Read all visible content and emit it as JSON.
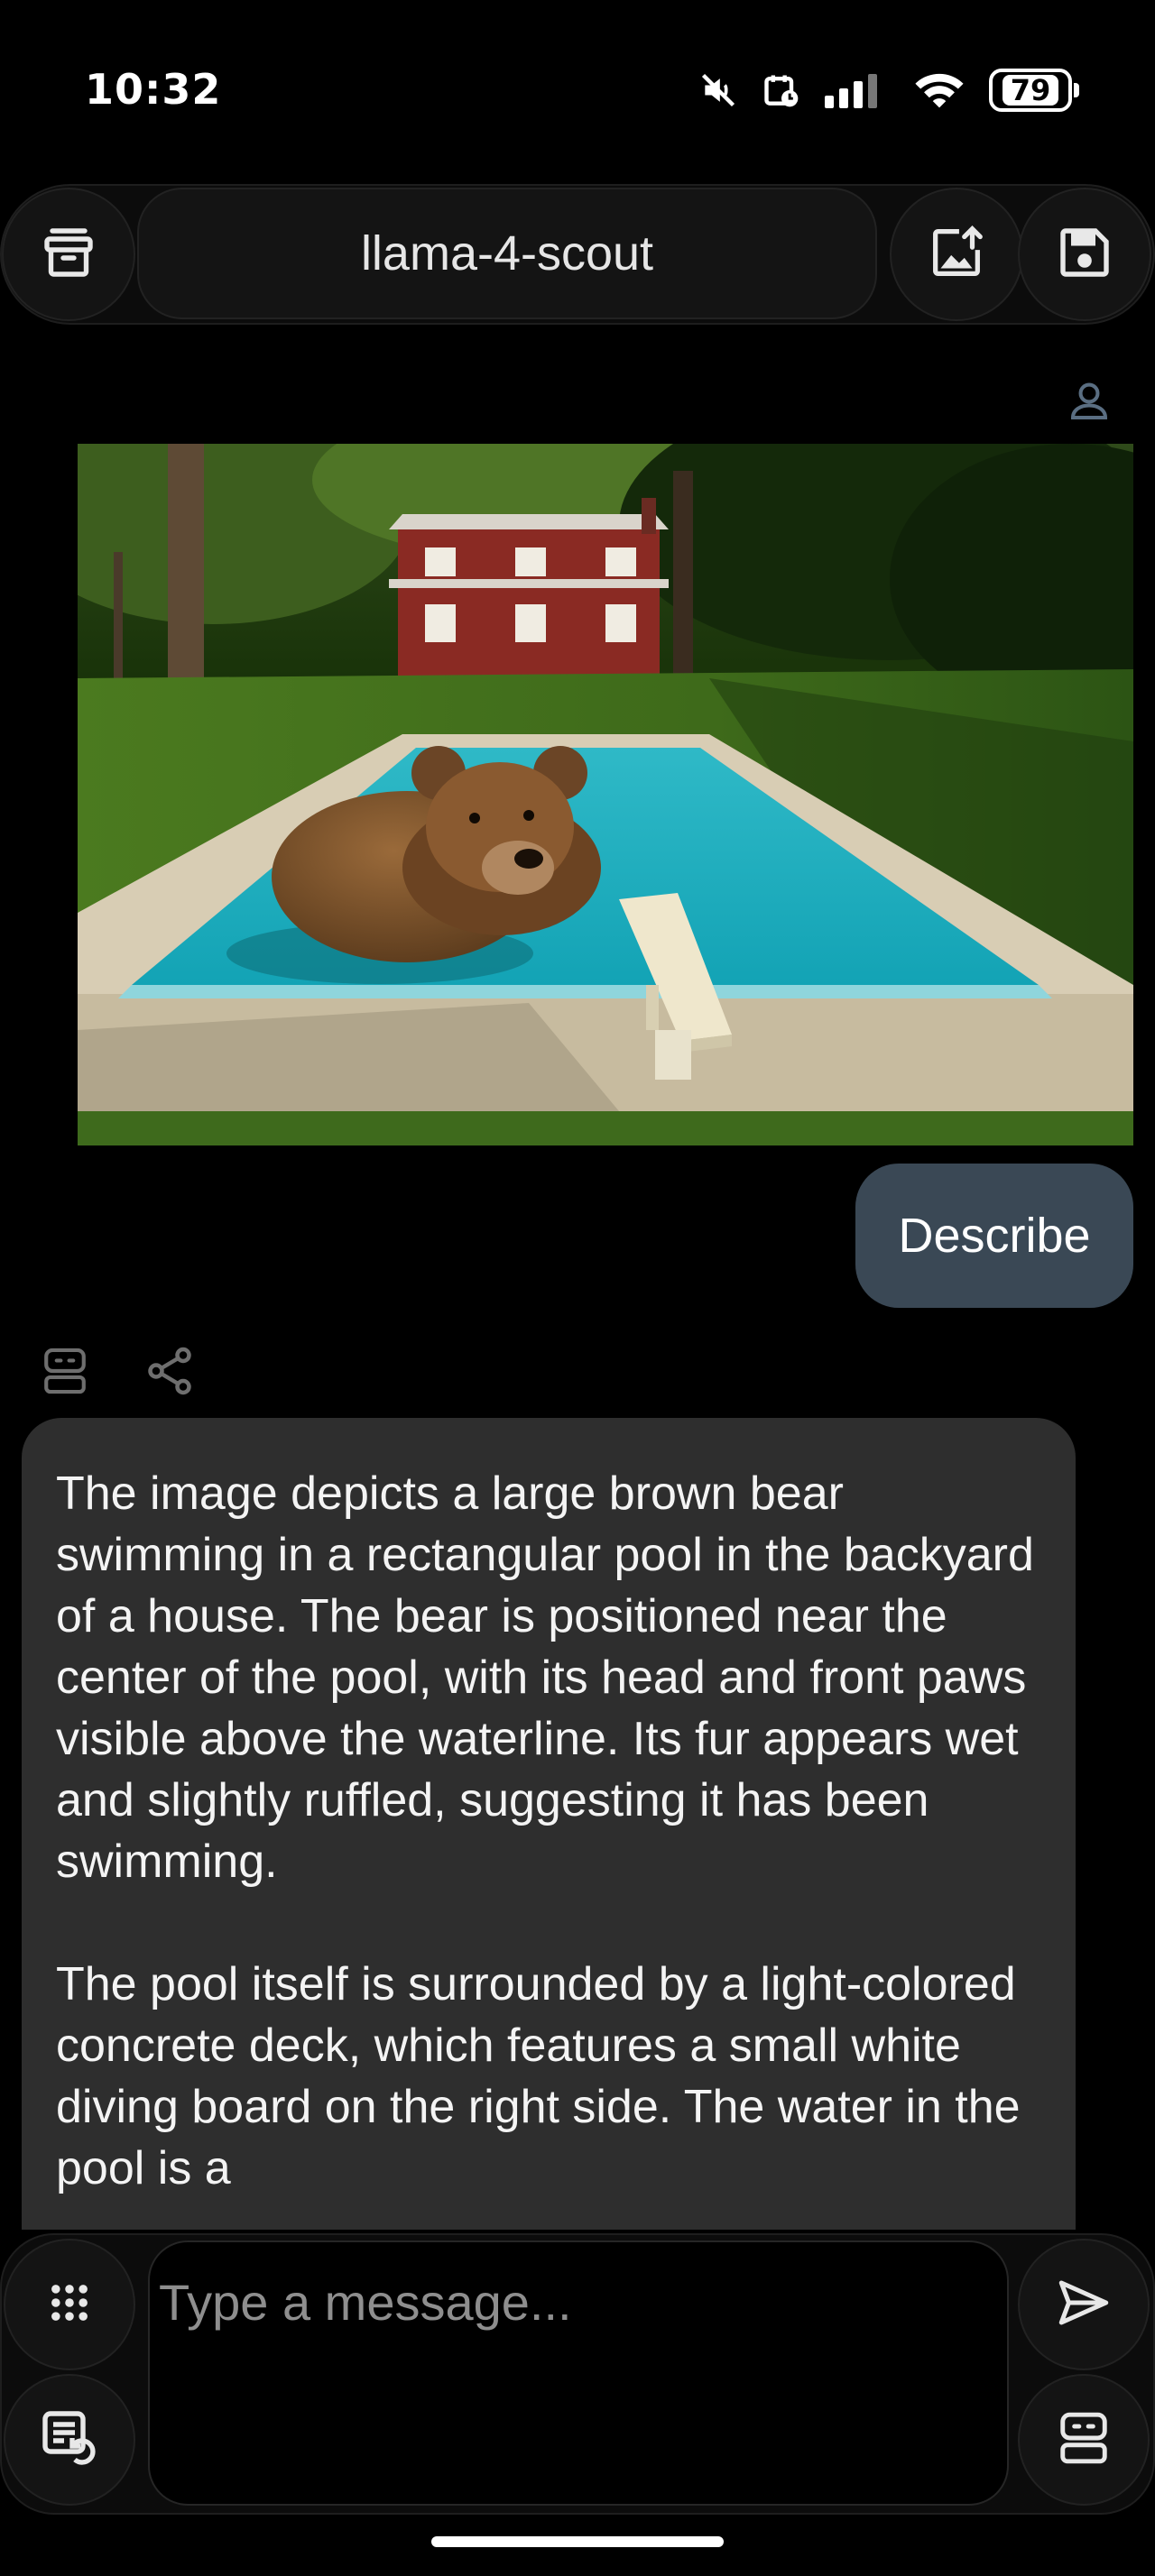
{
  "status_bar": {
    "time": "10:32",
    "battery_level": "79",
    "icons": [
      "mute-icon",
      "alarm-icon",
      "cellular-signal-icon",
      "wifi-icon",
      "battery-icon"
    ]
  },
  "header": {
    "model_name": "llama-4-scout",
    "left_icon": "archive-icon",
    "right_icons": [
      "export-image-icon",
      "save-icon"
    ]
  },
  "chat": {
    "user_icon": "user-icon",
    "user_image_icon": "attached-image",
    "user_message": "Describe",
    "bot_icons": [
      "bot-icon",
      "share-icon"
    ],
    "bot_paragraphs": [
      "The image depicts a large brown bear swimming in a rectangular pool in the backyard of a house. The bear is positioned near the center of the pool, with its head and front paws visible above the waterline. Its fur appears wet and slightly ruffled, suggesting it has been swimming.",
      "The pool itself is surrounded by a light-colored concrete deck, which features a small white diving board on the right side. The water in the pool is a"
    ]
  },
  "composer": {
    "placeholder": "Type a message...",
    "left_icons": [
      "grid-icon",
      "prompt-history-icon"
    ],
    "right_icons": [
      "send-icon",
      "bot-select-icon"
    ]
  },
  "colors": {
    "background": "#000000",
    "bot_bubble": "#2e2e2e",
    "user_bubble": "#3a4855",
    "icon_blue": "#5a6e82"
  }
}
